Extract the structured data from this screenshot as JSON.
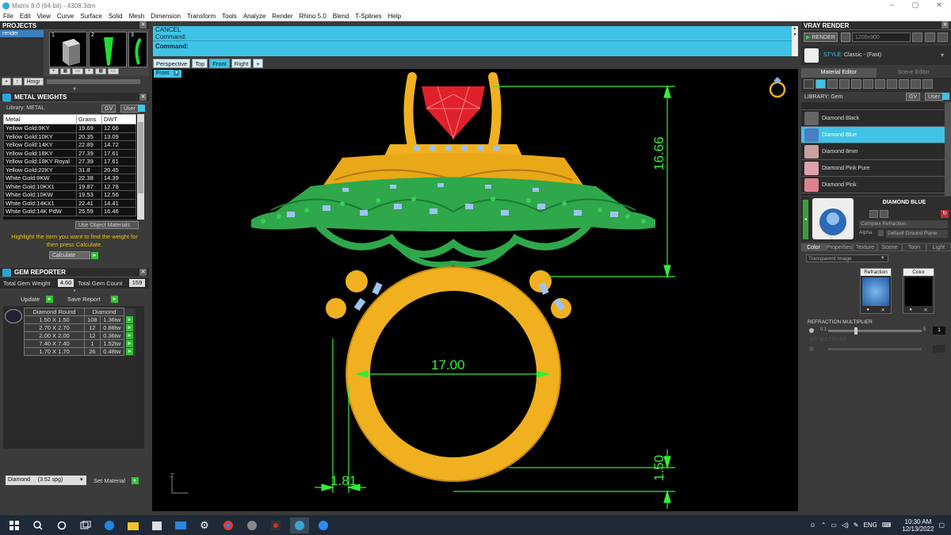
{
  "window": {
    "title": "Matrix 8.0 (64-bit) - 4308.3dm",
    "minimize": "–",
    "maximize": "▢",
    "close": "✕"
  },
  "menu": [
    "File",
    "Edit",
    "View",
    "Curve",
    "Surface",
    "Solid",
    "Mesh",
    "Dimension",
    "Transform",
    "Tools",
    "Analyze",
    "Render",
    "Rhino 5.0",
    "Blend",
    "T-Splines",
    "Help"
  ],
  "projects": {
    "title": "PROJECTS",
    "items": [
      "render"
    ],
    "thumb_numbers": [
      "1",
      "2",
      "3"
    ],
    "buttons": [
      "+",
      "↑",
      "Hmgr"
    ]
  },
  "metal_weights": {
    "title": "METAL WEIGHTS",
    "library_label": "Library: METAL",
    "library_buttons": [
      "GV",
      "User"
    ],
    "columns": [
      "Metal",
      "Grams",
      "DWT"
    ],
    "rows": [
      [
        "Yellow Gold:9KY",
        "19.69",
        "12.66"
      ],
      [
        "Yellow Gold:10KY",
        "20.35",
        "13.09"
      ],
      [
        "Yellow Gold:14KY",
        "22.89",
        "14.72"
      ],
      [
        "Yellow Gold:18KY",
        "27.39",
        "17.61"
      ],
      [
        "Yellow Gold:18KY Royal",
        "27.39",
        "17.61"
      ],
      [
        "Yellow Gold:22KY",
        "31.8",
        "20.45"
      ],
      [
        "White Gold:9KW",
        "22.38",
        "14.39"
      ],
      [
        "White Gold:10KX1",
        "19.87",
        "12.78"
      ],
      [
        "White Gold:10KW",
        "19.53",
        "12.56"
      ],
      [
        "White Gold:14KX1",
        "22.41",
        "14.41"
      ],
      [
        "White Gold:14K PdW",
        "25.59",
        "16.46"
      ]
    ],
    "use_object_materials": "Use Object Materials",
    "hint": "Highlight the item you want to find the weight for then press Calculate.",
    "calculate": "Calculate"
  },
  "gem_reporter": {
    "title": "GEM REPORTER",
    "total_weight_label": "Total Gem Weight",
    "total_weight": "4.60",
    "total_count_label": "Total Gem Count",
    "total_count": "159",
    "update": "Update",
    "save_report": "Save Report",
    "col_shape": "Diamond Round",
    "col_stone": "Diamond",
    "rows": [
      [
        "1.50 X 1.50",
        "108",
        "1.36tw"
      ],
      [
        "2.70 X 2.70",
        "12",
        "0.88tw"
      ],
      [
        "2.00 X 2.00",
        "12",
        "0.36tw"
      ],
      [
        "7.40 X 7.40",
        "1",
        "1.52tw"
      ],
      [
        "1.70 X 1.70",
        "26",
        "0.48tw"
      ]
    ],
    "material_select": "Diamond     (3.52 spg)",
    "set_material": "Set Material"
  },
  "command": {
    "line1": "CANCEL",
    "line2": "Command:",
    "line3": "Command:"
  },
  "view_tabs": [
    "Perspective",
    "Top",
    "Front",
    "Right",
    "+"
  ],
  "active_view_tab": "Front",
  "viewport_label": "Front",
  "dimensions": {
    "height": "16.66",
    "inner_diameter": "17.00",
    "band_width": "1.81",
    "band_thickness": "1.50"
  },
  "axis_label": "Z",
  "vray": {
    "title": "VRAY RENDER",
    "render": "RENDER",
    "resolution": "1200x900",
    "style_label": "STYLE:",
    "style_value": "Classic - (Fast)",
    "tabs": [
      "Material Editor",
      "Scene Editor"
    ],
    "library_label": "LIBRARY: Gem",
    "library_buttons": [
      "GV",
      "User"
    ],
    "materials": [
      "Diamond Black",
      "Diamond Blue",
      "Diamond 8mm",
      "Diamond Pink Pure",
      "Diamond Pink"
    ],
    "selected_material": "Diamond Blue",
    "preview_name": "DIAMOND BLUE",
    "complex_refraction": "Complex Refraction",
    "alpha": "Alpha",
    "ground": "Default Ground Plane",
    "sub_tabs": [
      "Color",
      "Properties",
      "Texture",
      "Scene",
      "Toon",
      "Light"
    ],
    "transparent_image": "Transparent Image",
    "refraction_label": "Refraction",
    "color_label": "Color",
    "refraction_multiplier": "REFRACTION MULTIPLIER",
    "slider_min": "0.1",
    "slider_max": "5",
    "slider_value": "1",
    "multiplier_fraction": 0.3,
    "disabled_label": "IOR MULTIPLIER"
  },
  "taskbar": {
    "lang": "ENG",
    "time": "10:30 AM",
    "date": "12/13/2022"
  },
  "colors": {
    "cyan": "#3fc3e6",
    "gold": "#f0b020",
    "green": "#2ea84a",
    "ruby": "#e0202a",
    "dimension": "#33ee33"
  }
}
